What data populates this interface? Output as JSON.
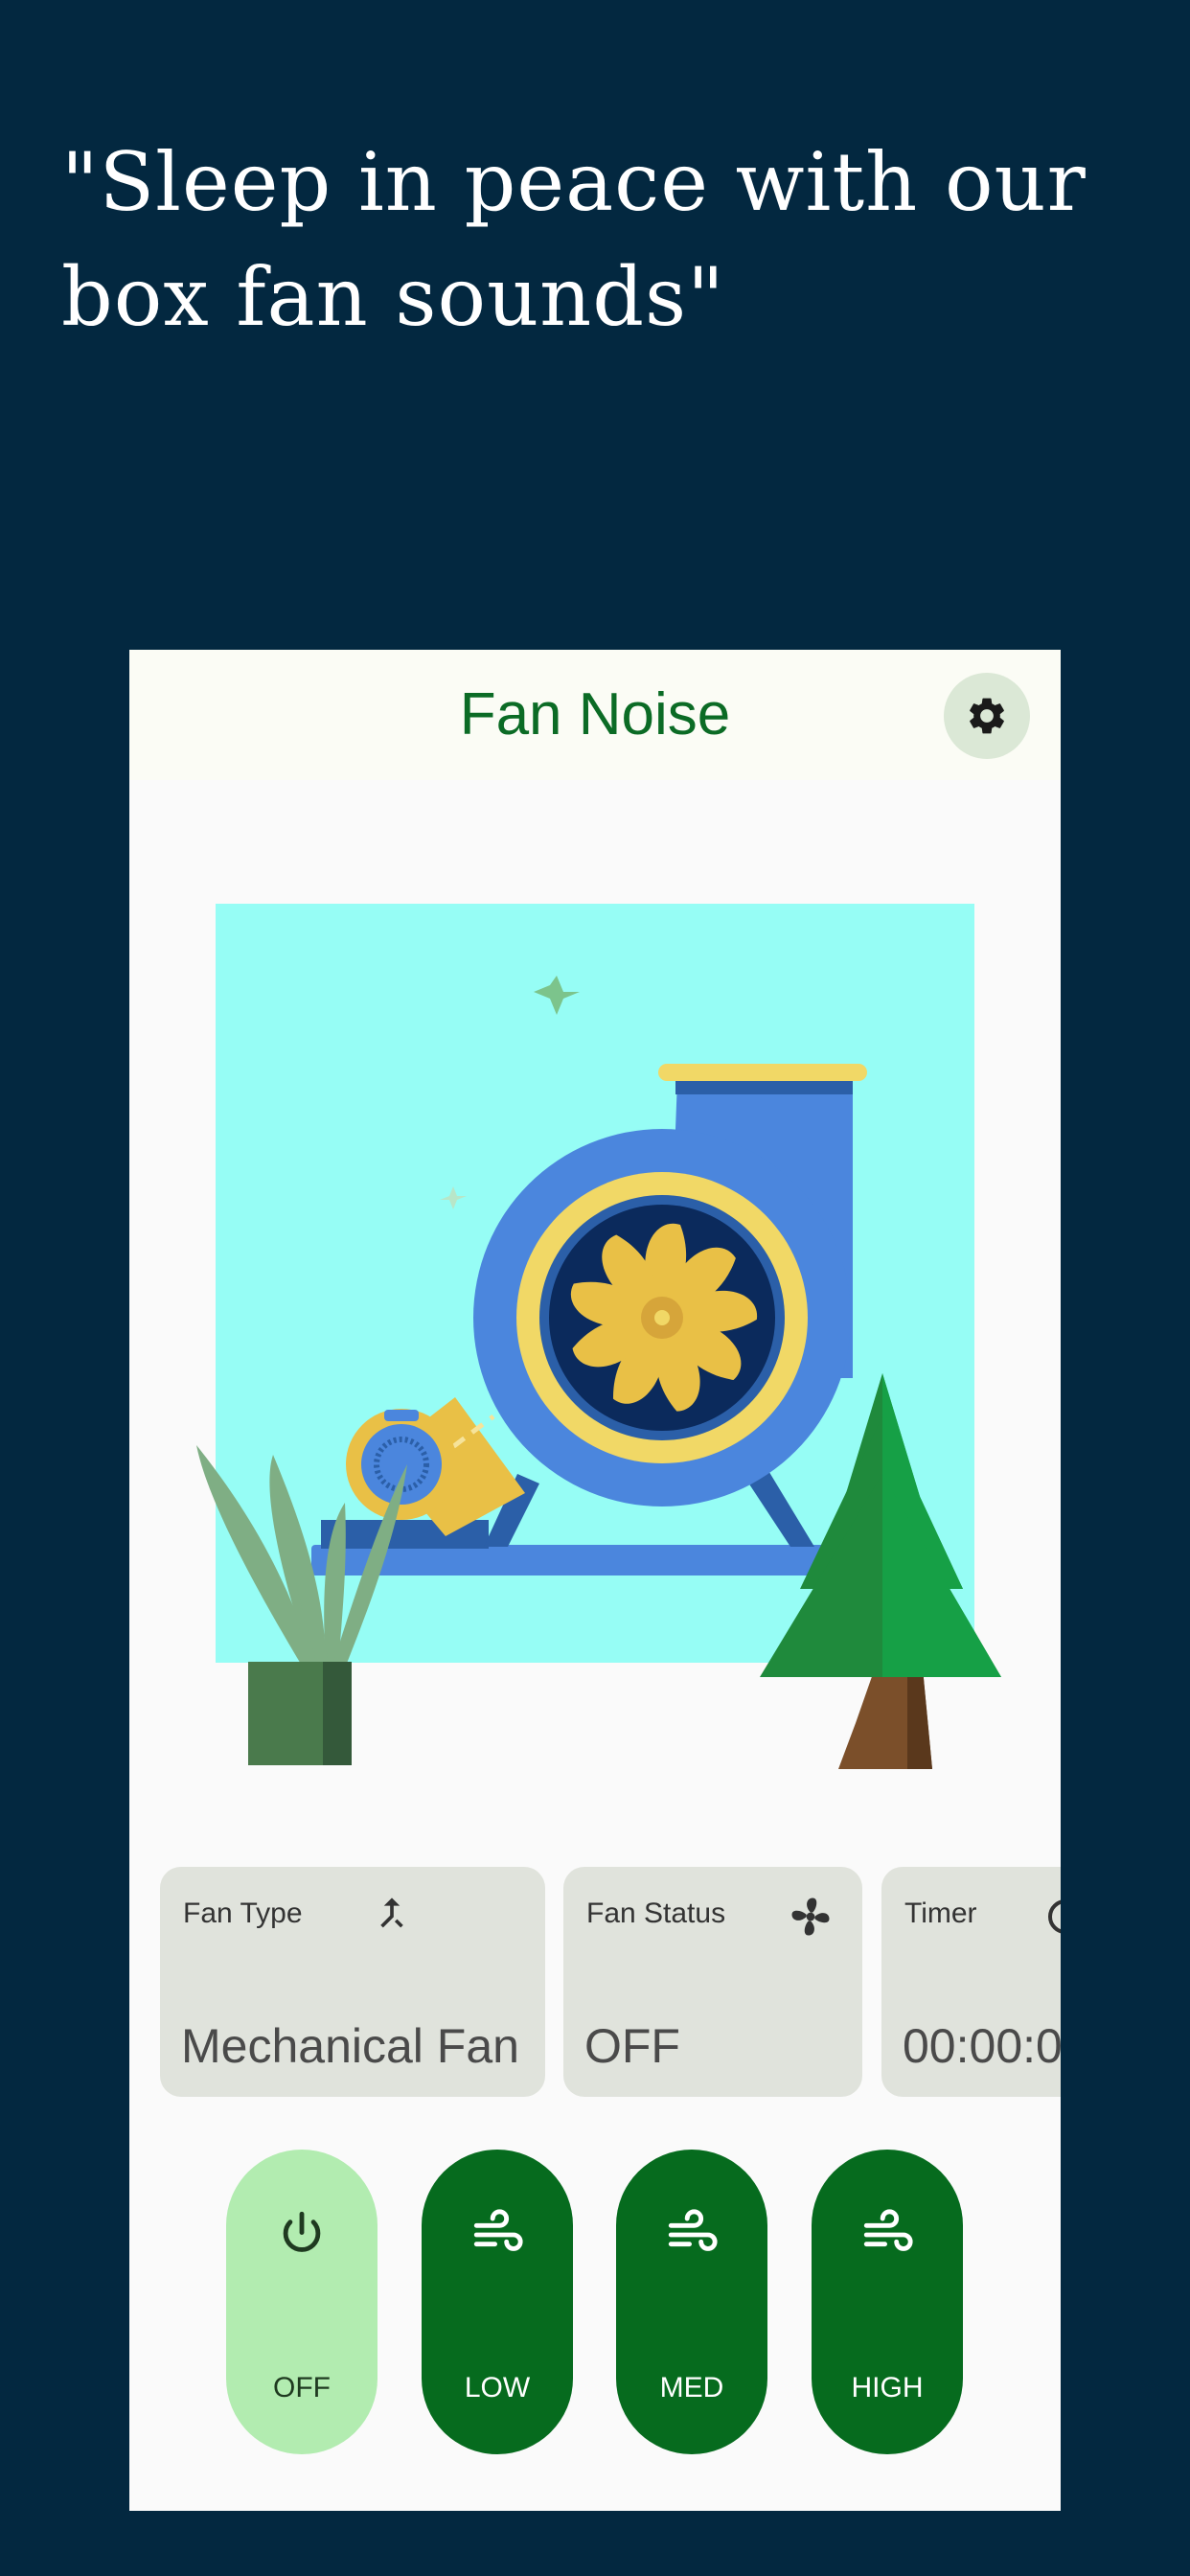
{
  "promo": {
    "headline": "\"Sleep in peace with our box fan sounds\""
  },
  "app": {
    "title": "Fan Noise",
    "settings_icon": "gear-icon"
  },
  "illustration": {
    "subject": "mechanical-fan",
    "colors": {
      "background": "#96fdf5",
      "fan_body": "#4b86dd",
      "blades": "#e9c046"
    }
  },
  "cards": [
    {
      "label": "Fan Type",
      "value": "Mechanical Fan",
      "icon": "merge-arrow-icon"
    },
    {
      "label": "Fan Status",
      "value": "OFF",
      "icon": "fan-icon"
    },
    {
      "label": "Timer",
      "value": "00:00:0",
      "icon": "timer-icon"
    }
  ],
  "controls": [
    {
      "label": "OFF",
      "icon": "power-icon",
      "selected": true
    },
    {
      "label": "LOW",
      "icon": "wind-icon",
      "selected": false
    },
    {
      "label": "MED",
      "icon": "wind-icon",
      "selected": false
    },
    {
      "label": "HIGH",
      "icon": "wind-icon",
      "selected": false
    }
  ],
  "colors": {
    "page_background": "#032840",
    "accent_green": "#0b6b25",
    "button_green": "#066b1e",
    "selected_button": "#b2ecb0",
    "card_background": "#e0e3dc"
  }
}
